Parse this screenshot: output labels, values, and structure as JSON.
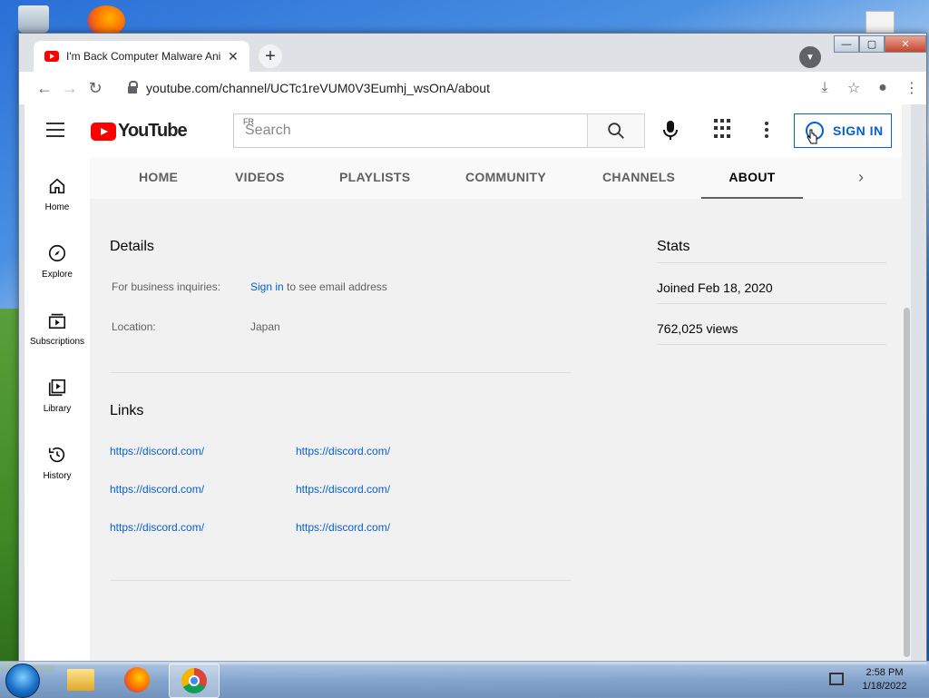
{
  "browser": {
    "tab_title": "I'm Back Computer Malware Ani",
    "tab_close": "✕",
    "new_tab": "+",
    "url": "youtube.com/channel/UCTc1reVUM0V3Eumhj_wsOnA/about",
    "icons": [
      "back-icon",
      "forward-icon",
      "reload-icon",
      "lock-icon",
      "install-icon",
      "star-icon",
      "profile-icon",
      "menu-icon"
    ]
  },
  "youtube": {
    "logo_text": "YouTube",
    "country_code": "FR",
    "search_placeholder": "Search",
    "signin_label": "SIGN IN",
    "sidebar": [
      {
        "label": "Home",
        "icon": "home-icon"
      },
      {
        "label": "Explore",
        "icon": "compass-icon"
      },
      {
        "label": "Subscriptions",
        "icon": "subscriptions-icon"
      },
      {
        "label": "Library",
        "icon": "library-icon"
      },
      {
        "label": "History",
        "icon": "history-icon"
      }
    ],
    "channel_tabs": [
      "HOME",
      "VIDEOS",
      "PLAYLISTS",
      "COMMUNITY",
      "CHANNELS",
      "ABOUT"
    ],
    "active_tab": "ABOUT",
    "details": {
      "heading": "Details",
      "business_label": "For business inquiries:",
      "business_link": "Sign in",
      "business_suffix": " to see email address",
      "location_label": "Location:",
      "location_value": "Japan"
    },
    "links": {
      "heading": "Links",
      "items": [
        "https://discord.com/",
        "https://discord.com/",
        "https://discord.com/",
        "https://discord.com/",
        "https://discord.com/",
        "https://discord.com/"
      ]
    },
    "stats": {
      "heading": "Stats",
      "joined": "Joined Feb 18, 2020",
      "views": "762,025 views"
    }
  },
  "taskbar": {
    "time": "2:58 PM",
    "date": "1/18/2022"
  }
}
